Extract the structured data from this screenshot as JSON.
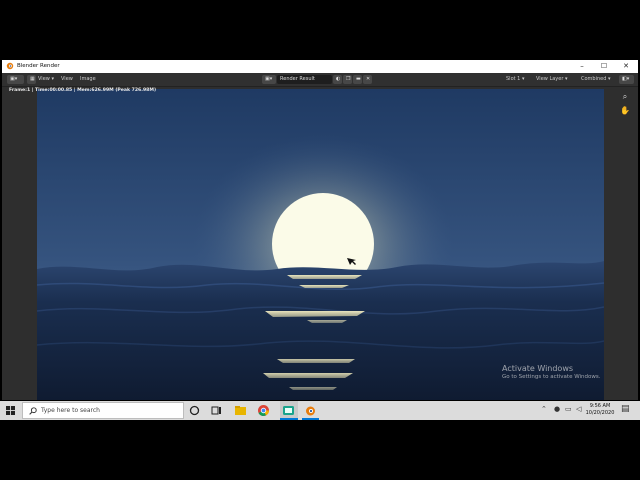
{
  "window": {
    "title": "Blender Render",
    "controls": {
      "minimize": "–",
      "maximize": "☐",
      "close": "✕"
    }
  },
  "header": {
    "menus": [
      "View",
      "View",
      "Image"
    ],
    "image_name": "Render Result",
    "slot": "Slot 1",
    "view_layer": "View Layer",
    "pass": "Combined"
  },
  "frame_info": "Frame:1 | Time:00:00.85 | Mem:626.99M (Peak 726.98M)",
  "watermark": {
    "line1": "Activate Windows",
    "line2": "Go to Settings to activate Windows."
  },
  "taskbar": {
    "search_placeholder": "Type here to search",
    "time": "9:56 AM",
    "date": "10/20/2020"
  },
  "colors": {
    "sky_top": "#1f3a63",
    "sky_horizon": "#4f6c93",
    "sea": "#13223c",
    "sun": "#fbfbe8",
    "windows_blue": "#0078d7",
    "blender_orange": "#e87d0d"
  }
}
